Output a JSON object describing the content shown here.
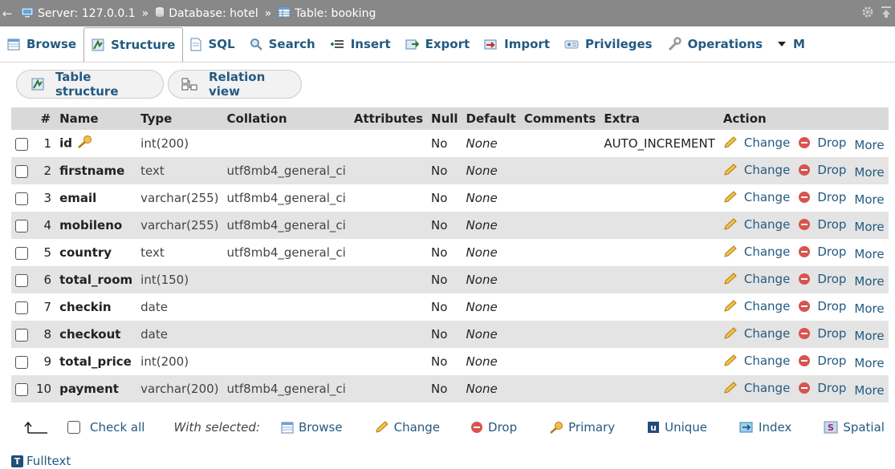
{
  "breadcrumb": {
    "server": "Server: 127.0.0.1",
    "database": "Database: hotel",
    "table": "Table: booking",
    "separator": "»"
  },
  "tabs": [
    {
      "label": "Browse",
      "icon": "browse-icon"
    },
    {
      "label": "Structure",
      "icon": "structure-icon",
      "active": true
    },
    {
      "label": "SQL",
      "icon": "sql-icon"
    },
    {
      "label": "Search",
      "icon": "search-icon"
    },
    {
      "label": "Insert",
      "icon": "insert-icon"
    },
    {
      "label": "Export",
      "icon": "export-icon"
    },
    {
      "label": "Import",
      "icon": "import-icon"
    },
    {
      "label": "Privileges",
      "icon": "privileges-icon"
    },
    {
      "label": "Operations",
      "icon": "operations-icon"
    },
    {
      "label": "M",
      "icon": "more-dropdown-icon"
    }
  ],
  "subnav": {
    "table_structure": "Table structure",
    "relation_view": "Relation view"
  },
  "table": {
    "headers": [
      "#",
      "Name",
      "Type",
      "Collation",
      "Attributes",
      "Null",
      "Default",
      "Comments",
      "Extra",
      "Action"
    ],
    "rows": [
      {
        "num": "1",
        "name": "id",
        "type": "int(200)",
        "collation": "",
        "null": "No",
        "default": "None",
        "extra": "AUTO_INCREMENT",
        "primary_key": true
      },
      {
        "num": "2",
        "name": "firstname",
        "type": "text",
        "collation": "utf8mb4_general_ci",
        "null": "No",
        "default": "None",
        "extra": ""
      },
      {
        "num": "3",
        "name": "email",
        "type": "varchar(255)",
        "collation": "utf8mb4_general_ci",
        "null": "No",
        "default": "None",
        "extra": ""
      },
      {
        "num": "4",
        "name": "mobileno",
        "type": "varchar(255)",
        "collation": "utf8mb4_general_ci",
        "null": "No",
        "default": "None",
        "extra": ""
      },
      {
        "num": "5",
        "name": "country",
        "type": "text",
        "collation": "utf8mb4_general_ci",
        "null": "No",
        "default": "None",
        "extra": ""
      },
      {
        "num": "6",
        "name": "total_room",
        "type": "int(150)",
        "collation": "",
        "null": "No",
        "default": "None",
        "extra": ""
      },
      {
        "num": "7",
        "name": "checkin",
        "type": "date",
        "collation": "",
        "null": "No",
        "default": "None",
        "extra": ""
      },
      {
        "num": "8",
        "name": "checkout",
        "type": "date",
        "collation": "",
        "null": "No",
        "default": "None",
        "extra": ""
      },
      {
        "num": "9",
        "name": "total_price",
        "type": "int(200)",
        "collation": "",
        "null": "No",
        "default": "None",
        "extra": ""
      },
      {
        "num": "10",
        "name": "payment",
        "type": "varchar(200)",
        "collation": "utf8mb4_general_ci",
        "null": "No",
        "default": "None",
        "extra": ""
      }
    ],
    "actions": {
      "change": "Change",
      "drop": "Drop",
      "more": "More"
    }
  },
  "footer": {
    "check_all": "Check all",
    "with_selected": "With selected:",
    "browse": "Browse",
    "change": "Change",
    "drop": "Drop",
    "primary": "Primary",
    "unique": "Unique",
    "index": "Index",
    "spatial": "Spatial",
    "fulltext": "Fulltext"
  },
  "colors": {
    "link": "#235a81",
    "breadcrumb_bg": "#888888",
    "header_bg": "#d9d9d9",
    "even_row_bg": "#e4e4e4",
    "drop_red": "#d9534f",
    "pencil_gold": "#e0a92b"
  }
}
